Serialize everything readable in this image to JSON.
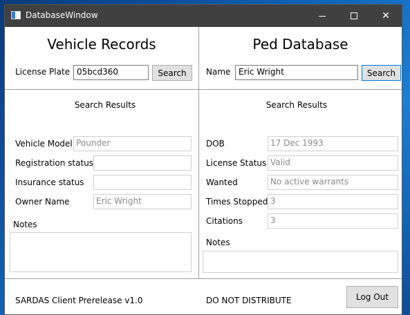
{
  "window": {
    "title": "DatabaseWindow",
    "min_label": "minimize",
    "max_label": "maximize",
    "close_label": "✕"
  },
  "vehicle": {
    "heading": "Vehicle Records",
    "plate_label": "License Plate",
    "plate_value": "05bcd360",
    "search_label": "Search",
    "results_heading": "Search Results",
    "fields": [
      {
        "label": "Vehicle Model",
        "value": "Pounder"
      },
      {
        "label": "Registration status",
        "value": ""
      },
      {
        "label": "Insurance status",
        "value": ""
      },
      {
        "label": "Owner Name",
        "value": "Eric Wright"
      }
    ],
    "notes_label": "Notes",
    "notes_value": ""
  },
  "ped": {
    "heading": "Ped Database",
    "name_label": "Name",
    "name_value": "Eric Wright",
    "search_label": "Search",
    "results_heading": "Search Results",
    "fields": [
      {
        "label": "DOB",
        "value": "17 Dec 1993"
      },
      {
        "label": "License Status",
        "value": "Valid"
      },
      {
        "label": "Wanted",
        "value": "No active warrants"
      },
      {
        "label": "Times Stopped",
        "value": "3"
      },
      {
        "label": "Citations",
        "value": "3"
      }
    ],
    "notes_label": "Notes",
    "notes_value": ""
  },
  "footer": {
    "version": "SARDAS Client Prerelease v1.0",
    "notice": "DO NOT DISTRIBUTE",
    "logout_label": "Log Out"
  }
}
